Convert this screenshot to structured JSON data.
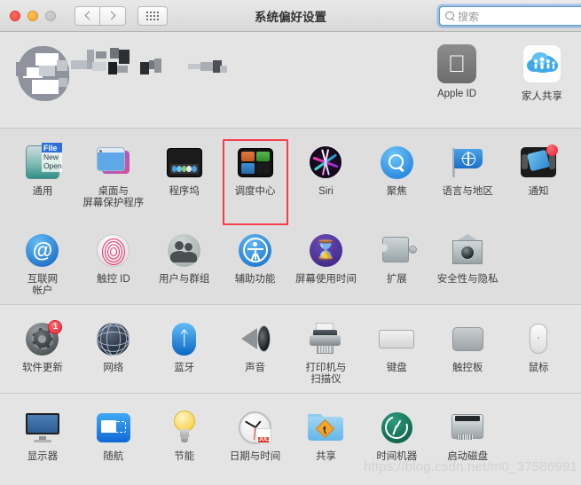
{
  "window": {
    "title": "系统偏好设置",
    "traffic_lights": [
      "close",
      "minimize",
      "zoom"
    ],
    "nav": {
      "back": "‹",
      "forward": "›",
      "show_all": "show-all-grid"
    }
  },
  "search": {
    "placeholder": "搜索",
    "value": "",
    "icon": "search-icon"
  },
  "account": {
    "profile_redacted": true,
    "items": [
      {
        "label": "Apple ID",
        "icon": "apple-logo-icon"
      },
      {
        "label": "家人共享",
        "icon": "family-sharing-icon"
      }
    ]
  },
  "sections": [
    {
      "name": "personal",
      "items": [
        {
          "label": "通用",
          "icon": "general-icon",
          "selected": false
        },
        {
          "label": "桌面与\n屏幕保护程序",
          "icon": "desktop-screensaver-icon",
          "selected": false
        },
        {
          "label": "程序坞",
          "icon": "dock-icon",
          "selected": false
        },
        {
          "label": "调度中心",
          "icon": "mission-control-icon",
          "selected": true
        },
        {
          "label": "Siri",
          "icon": "siri-icon",
          "selected": false
        },
        {
          "label": "聚焦",
          "icon": "spotlight-icon",
          "selected": false
        },
        {
          "label": "语言与地区",
          "icon": "language-region-icon",
          "selected": false
        },
        {
          "label": "通知",
          "icon": "notifications-icon",
          "selected": false
        }
      ]
    },
    {
      "name": "accounts",
      "items": [
        {
          "label": "互联网\n帐户",
          "icon": "internet-accounts-icon",
          "selected": false
        },
        {
          "label": "触控 ID",
          "icon": "touch-id-icon",
          "selected": false
        },
        {
          "label": "用户与群组",
          "icon": "users-groups-icon",
          "selected": false
        },
        {
          "label": "辅助功能",
          "icon": "accessibility-icon",
          "selected": false
        },
        {
          "label": "屏幕使用时间",
          "icon": "screen-time-icon",
          "selected": false
        },
        {
          "label": "扩展",
          "icon": "extensions-icon",
          "selected": false
        },
        {
          "label": "安全性与隐私",
          "icon": "security-privacy-icon",
          "selected": false
        }
      ]
    },
    {
      "name": "hardware",
      "items": [
        {
          "label": "软件更新",
          "icon": "software-update-icon",
          "badge": "1",
          "selected": false
        },
        {
          "label": "网络",
          "icon": "network-icon",
          "selected": false
        },
        {
          "label": "蓝牙",
          "icon": "bluetooth-icon",
          "selected": false
        },
        {
          "label": "声音",
          "icon": "sound-icon",
          "selected": false
        },
        {
          "label": "打印机与\n扫描仪",
          "icon": "printers-scanners-icon",
          "selected": false
        },
        {
          "label": "键盘",
          "icon": "keyboard-icon",
          "selected": false
        },
        {
          "label": "触控板",
          "icon": "trackpad-icon",
          "selected": false
        },
        {
          "label": "鼠标",
          "icon": "mouse-icon",
          "selected": false
        }
      ]
    },
    {
      "name": "system",
      "items": [
        {
          "label": "显示器",
          "icon": "displays-icon",
          "selected": false
        },
        {
          "label": "随航",
          "icon": "sidecar-icon",
          "selected": false
        },
        {
          "label": "节能",
          "icon": "energy-saver-icon",
          "selected": false
        },
        {
          "label": "日期与时间",
          "icon": "date-time-icon",
          "calendar_month": "JUL",
          "calendar_day": "18",
          "selected": false
        },
        {
          "label": "共享",
          "icon": "sharing-icon",
          "selected": false
        },
        {
          "label": "时间机器",
          "icon": "time-machine-icon",
          "selected": false
        },
        {
          "label": "启动磁盘",
          "icon": "startup-disk-icon",
          "selected": false
        }
      ]
    }
  ],
  "watermark": "https://blog.csdn.net/m0_37586991",
  "colors": {
    "selection_red": "#f73b4b",
    "badge_red": "#e8263c",
    "search_focus_blue": "#5b9ad6",
    "window_bg": "#e4e4e4"
  }
}
